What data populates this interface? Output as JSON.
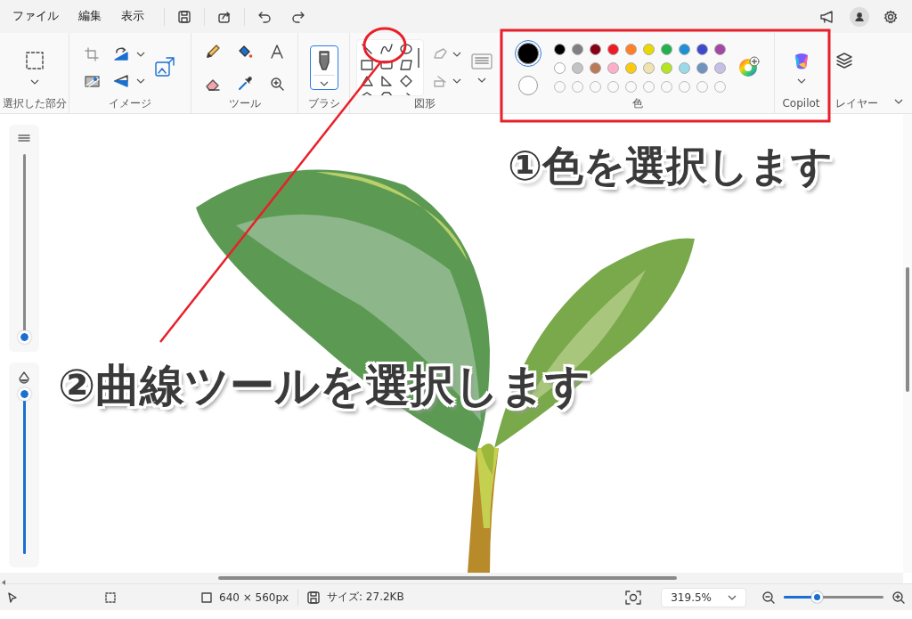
{
  "menu": [
    {
      "label": "ファイル"
    },
    {
      "label": "編集"
    },
    {
      "label": "表示"
    }
  ],
  "ribbon": {
    "selection": {
      "label": "選択した部分"
    },
    "image": {
      "label": "イメージ"
    },
    "tools": {
      "label": "ツール"
    },
    "brush": {
      "label": "ブラシ",
      "selected": true
    },
    "shapes": {
      "label": "図形"
    },
    "colors": {
      "label": "色",
      "current": [
        {
          "color": "#000000"
        },
        {
          "color": "#ffffff"
        }
      ],
      "palette": [
        {
          "color": "#000000"
        },
        {
          "color": "#7f7f7f"
        },
        {
          "color": "#880015"
        },
        {
          "color": "#ed1c24"
        },
        {
          "color": "#ff7f27"
        },
        {
          "color": "#e8d900"
        },
        {
          "color": "#22b14c"
        },
        {
          "color": "#1f8fd6"
        },
        {
          "color": "#3f48cc"
        },
        {
          "color": "#a349a4"
        },
        {
          "color": "#ffffff"
        },
        {
          "color": "#c3c3c3"
        },
        {
          "color": "#b97a57"
        },
        {
          "color": "#ffaec9"
        },
        {
          "color": "#ffc90e"
        },
        {
          "color": "#efe4b0"
        },
        {
          "color": "#b5e61d"
        },
        {
          "color": "#99d9ea"
        },
        {
          "color": "#7092be"
        },
        {
          "color": "#c8bfe7"
        },
        {
          "kind": "empty"
        },
        {
          "kind": "empty"
        },
        {
          "kind": "empty"
        },
        {
          "kind": "empty"
        },
        {
          "kind": "empty"
        },
        {
          "kind": "empty"
        },
        {
          "kind": "empty"
        },
        {
          "kind": "empty"
        },
        {
          "kind": "empty"
        },
        {
          "kind": "empty"
        }
      ]
    },
    "copilot": {
      "label": "Copilot"
    },
    "layers": {
      "label": "レイヤー"
    }
  },
  "side_sliders": [
    {
      "kind": "size",
      "level": 0
    },
    {
      "kind": "opacity",
      "level": 1
    }
  ],
  "annotations": [
    {
      "text": "①色を選択します"
    },
    {
      "text": "②曲線ツールを選択します"
    }
  ],
  "status_bar": {
    "canvas_size": "640 × 560px",
    "file_size": "サイズ: 27.2KB",
    "zoom": "319.5%",
    "zoom_slider": {
      "level": 0.33
    }
  }
}
